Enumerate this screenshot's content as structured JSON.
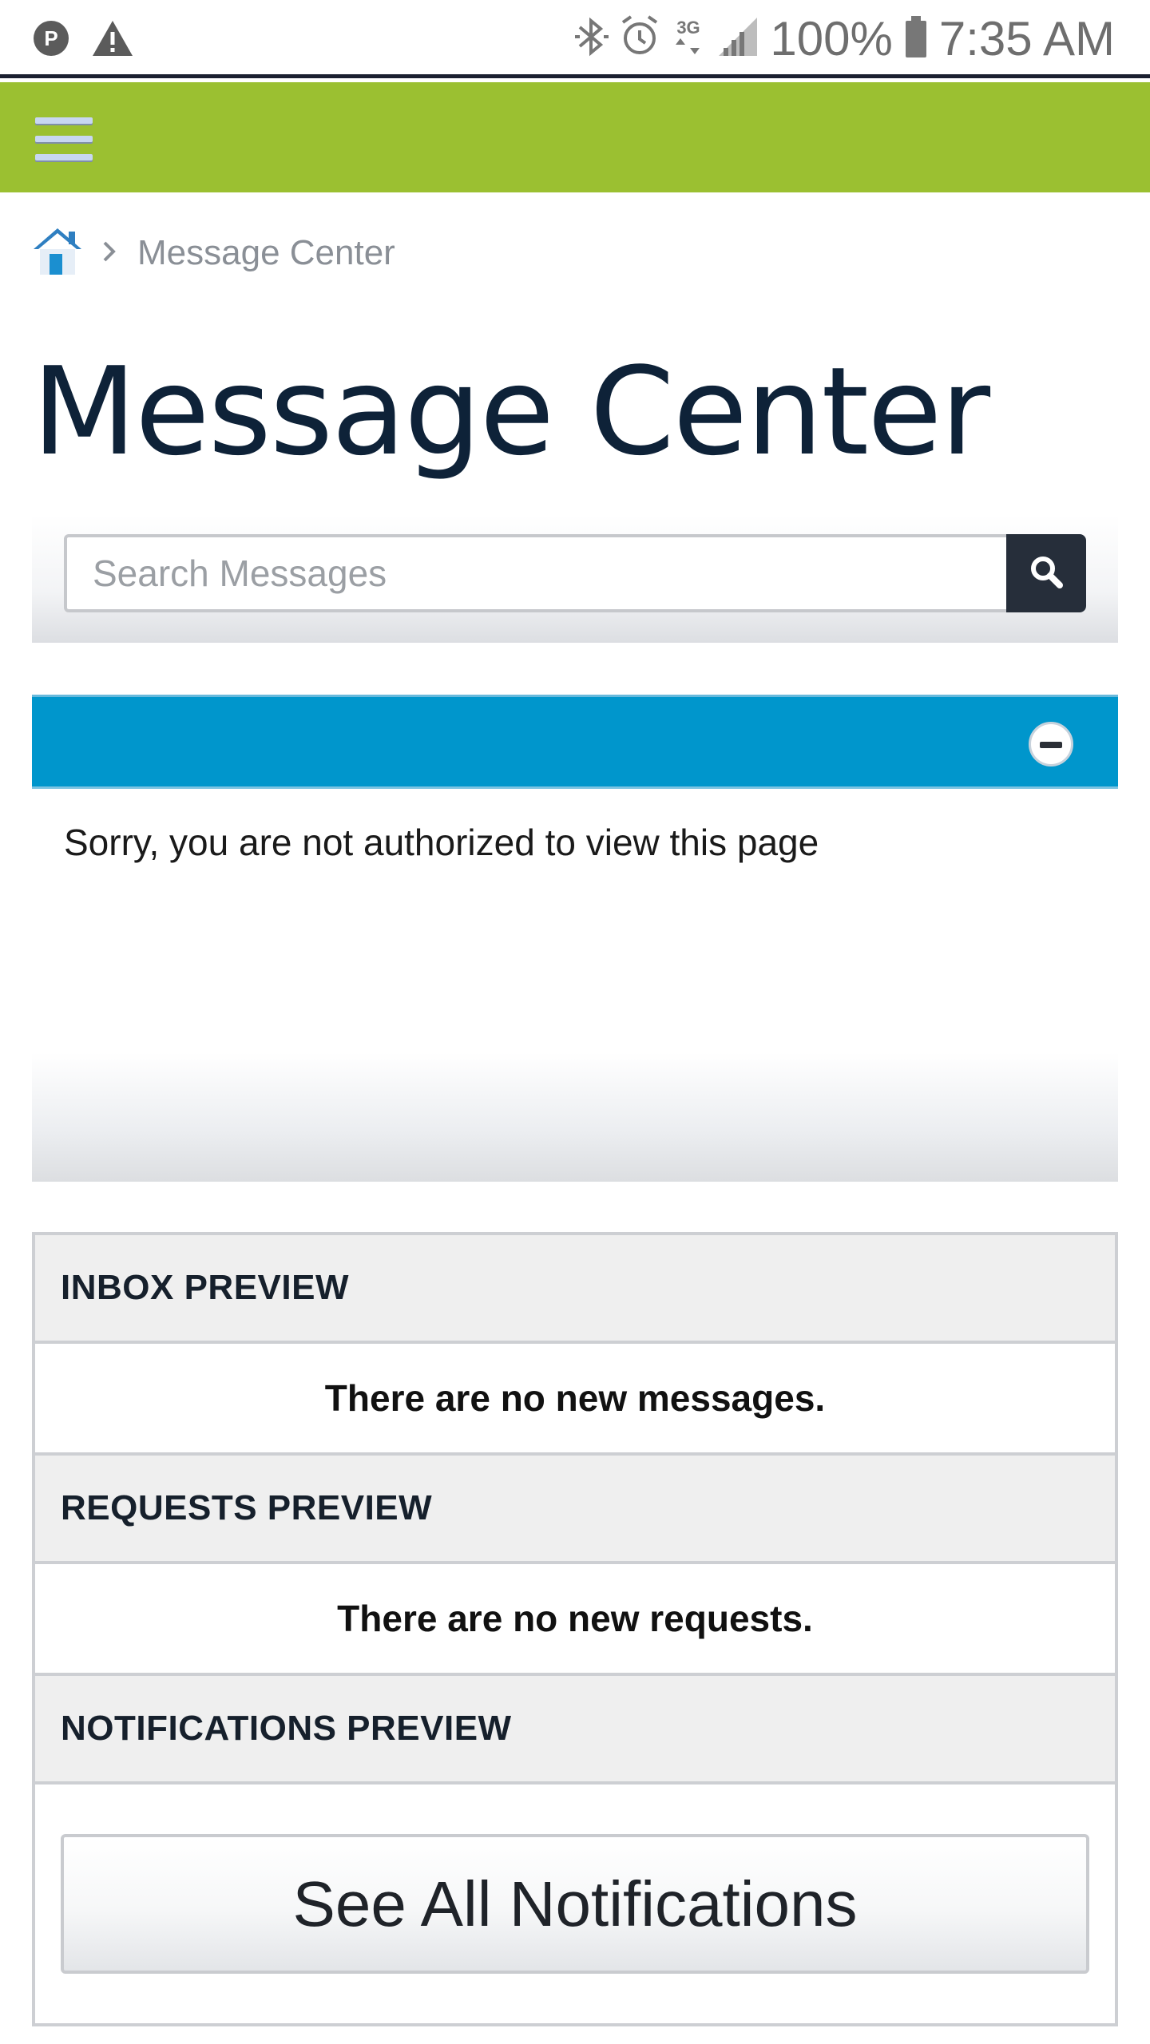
{
  "status_bar": {
    "battery": "100%",
    "time": "7:35 AM",
    "network": "3G",
    "icons": [
      "parking-icon",
      "warning-icon",
      "bluetooth-icon",
      "alarm-icon",
      "data-3g-icon",
      "signal-icon",
      "battery-icon"
    ]
  },
  "header": {
    "menu_icon": "hamburger-icon",
    "bar_color": "#9bc031"
  },
  "breadcrumb": {
    "home_icon": "home-icon",
    "current": "Message Center"
  },
  "page": {
    "title": "Message Center"
  },
  "search": {
    "placeholder": "Search Messages",
    "icon": "search-icon"
  },
  "alert_bar": {
    "color": "#0096cc",
    "collapse_icon": "minus-circle-icon"
  },
  "auth_message": "Sorry, you are not authorized to view this page",
  "previews": {
    "inbox": {
      "header": "INBOX PREVIEW",
      "body": "There are no new messages."
    },
    "requests": {
      "header": "REQUESTS PREVIEW",
      "body": "There are no new requests."
    },
    "notifications": {
      "header": "NOTIFICATIONS PREVIEW",
      "button": "See All Notifications"
    }
  }
}
